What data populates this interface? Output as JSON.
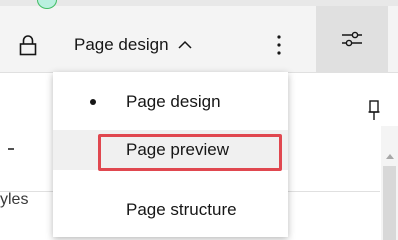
{
  "toolbar": {
    "mode_label": "Page design",
    "lock_icon": "lock-icon",
    "chevron_icon": "chevron-up-icon",
    "overflow_icon": "overflow-menu-vertical-icon",
    "settings_icon": "settings-adjust-icon"
  },
  "menu": {
    "items": [
      {
        "label": "Page design",
        "selected": true
      },
      {
        "label": "Page preview",
        "selected": false
      },
      {
        "label": "Page structure",
        "selected": false
      }
    ],
    "highlight_color": "#e0474f"
  },
  "background": {
    "styles_fragment": "yles"
  },
  "colors": {
    "toolbar_bg": "#f4f4f4",
    "active_button_bg": "#e0e0e0",
    "status_green": "#42be65"
  }
}
